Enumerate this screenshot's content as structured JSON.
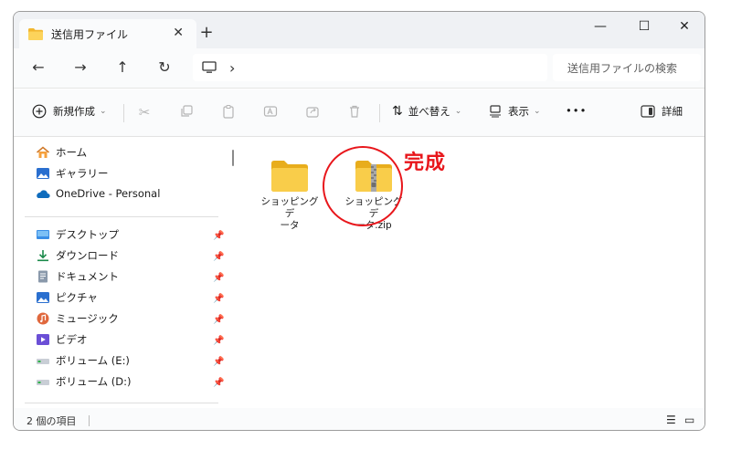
{
  "tab": {
    "title": "送信用ファイル",
    "close": "✕",
    "new_tab": "+"
  },
  "window_controls": {
    "minimize": "—",
    "maximize": "☐",
    "close": "✕"
  },
  "nav": {
    "back": "←",
    "forward": "→",
    "up": "↑",
    "refresh": "↻"
  },
  "address": {
    "chevron": "›"
  },
  "search": {
    "placeholder": "送信用ファイルの検索"
  },
  "commands": {
    "new_label": "新規作成",
    "sort_label": "並べ替え",
    "view_label": "表示",
    "more": "•••",
    "details_label": "詳細"
  },
  "sidebar": {
    "items": [
      {
        "label": "ホーム",
        "icon": "home-icon"
      },
      {
        "label": "ギャラリー",
        "icon": "gallery-icon"
      },
      {
        "label": "OneDrive - Personal",
        "icon": "onedrive-icon"
      }
    ],
    "quick_access": [
      {
        "label": "デスクトップ",
        "icon": "desktop-icon"
      },
      {
        "label": "ダウンロード",
        "icon": "download-icon"
      },
      {
        "label": "ドキュメント",
        "icon": "document-icon"
      },
      {
        "label": "ピクチャ",
        "icon": "pictures-icon"
      },
      {
        "label": "ミュージック",
        "icon": "music-icon"
      },
      {
        "label": "ビデオ",
        "icon": "video-icon"
      },
      {
        "label": "ボリューム (E:)",
        "icon": "drive-icon"
      },
      {
        "label": "ボリューム (D:)",
        "icon": "drive-icon"
      }
    ]
  },
  "files": [
    {
      "name_line1": "ショッピングデ",
      "name_line2": "ータ",
      "type": "folder"
    },
    {
      "name_line1": "ショッピングデ",
      "name_line2": "ータ.zip",
      "type": "zip"
    }
  ],
  "annotation": {
    "text": "完成",
    "color": "#e8161b"
  },
  "status": {
    "count": "2 個の項目"
  },
  "colors": {
    "folder": "#f6c844",
    "folder_dark": "#e8ad1c",
    "accent": "#0f6cbd"
  }
}
